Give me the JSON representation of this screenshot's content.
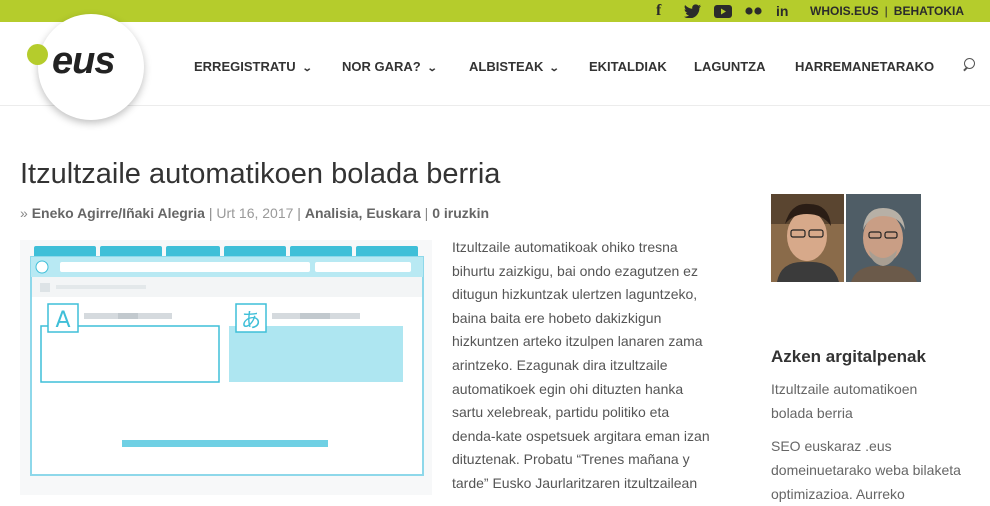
{
  "topbar": {
    "social": [
      {
        "icon": "facebook-icon",
        "glyph": "f"
      },
      {
        "icon": "twitter-icon",
        "glyph": "🐦"
      },
      {
        "icon": "youtube-icon",
        "glyph": "▶"
      },
      {
        "icon": "flickr-icon",
        "glyph": "●●"
      },
      {
        "icon": "linkedin-icon",
        "glyph": "in"
      }
    ],
    "links": [
      "WHOIS.EUS",
      "BEHATOKIA"
    ],
    "separator": "|",
    "color": "#b5cc2c"
  },
  "logo": {
    "text": "eus"
  },
  "nav": {
    "items": [
      {
        "label": "ERREGISTRATU",
        "dropdown": true
      },
      {
        "label": "NOR GARA?",
        "dropdown": true
      },
      {
        "label": "ALBISTEAK",
        "dropdown": true
      },
      {
        "label": "EKITALDIAK",
        "dropdown": false
      },
      {
        "label": "LAGUNTZA",
        "dropdown": false
      },
      {
        "label": "HARREMANETARAKO",
        "dropdown": false
      }
    ],
    "chevron": "⌄"
  },
  "article": {
    "title": "Itzultzaile automatikoen bolada berria",
    "meta": {
      "prefix": "» ",
      "authors": "Eneko Agirre/Iñaki Alegria",
      "sep": " | ",
      "date": "Urt 16, 2017",
      "categories": "Analisia, Euskara",
      "comments": "0 iruzkin"
    },
    "illustration": {
      "left_glyph": "A",
      "right_glyph": "あ"
    },
    "body_lines": [
      "Itzultzaile automatikoak ohiko tresna",
      "bihurtu zaizkigu, bai ondo ezagutzen ez",
      "ditugun hizkuntzak ulertzen laguntzeko,",
      "baina baita ere hobeto dakizkigun",
      "hizkuntzen arteko itzulpen lanaren zama",
      "arintzeko. Ezagunak dira itzultzaile",
      "automatikoek egin ohi dituzten hanka",
      "sartu xelebreak, partidu politiko eta",
      "denda-kate ospetsuek argitara eman izan",
      "dituztenak. Probatu “Trenes mañana y",
      "tarde” Eusko Jaurlaritzaren itzultzailean"
    ]
  },
  "sidebar": {
    "heading": "Azken argitalpenak",
    "recent": [
      {
        "lines": [
          "Itzultzaile automatikoen",
          "bolada berria"
        ]
      },
      {
        "lines": [
          "SEO euskaraz .eus",
          "domeinuetarako weba bilaketa",
          "optimizazioa. Aurreko"
        ]
      }
    ]
  }
}
